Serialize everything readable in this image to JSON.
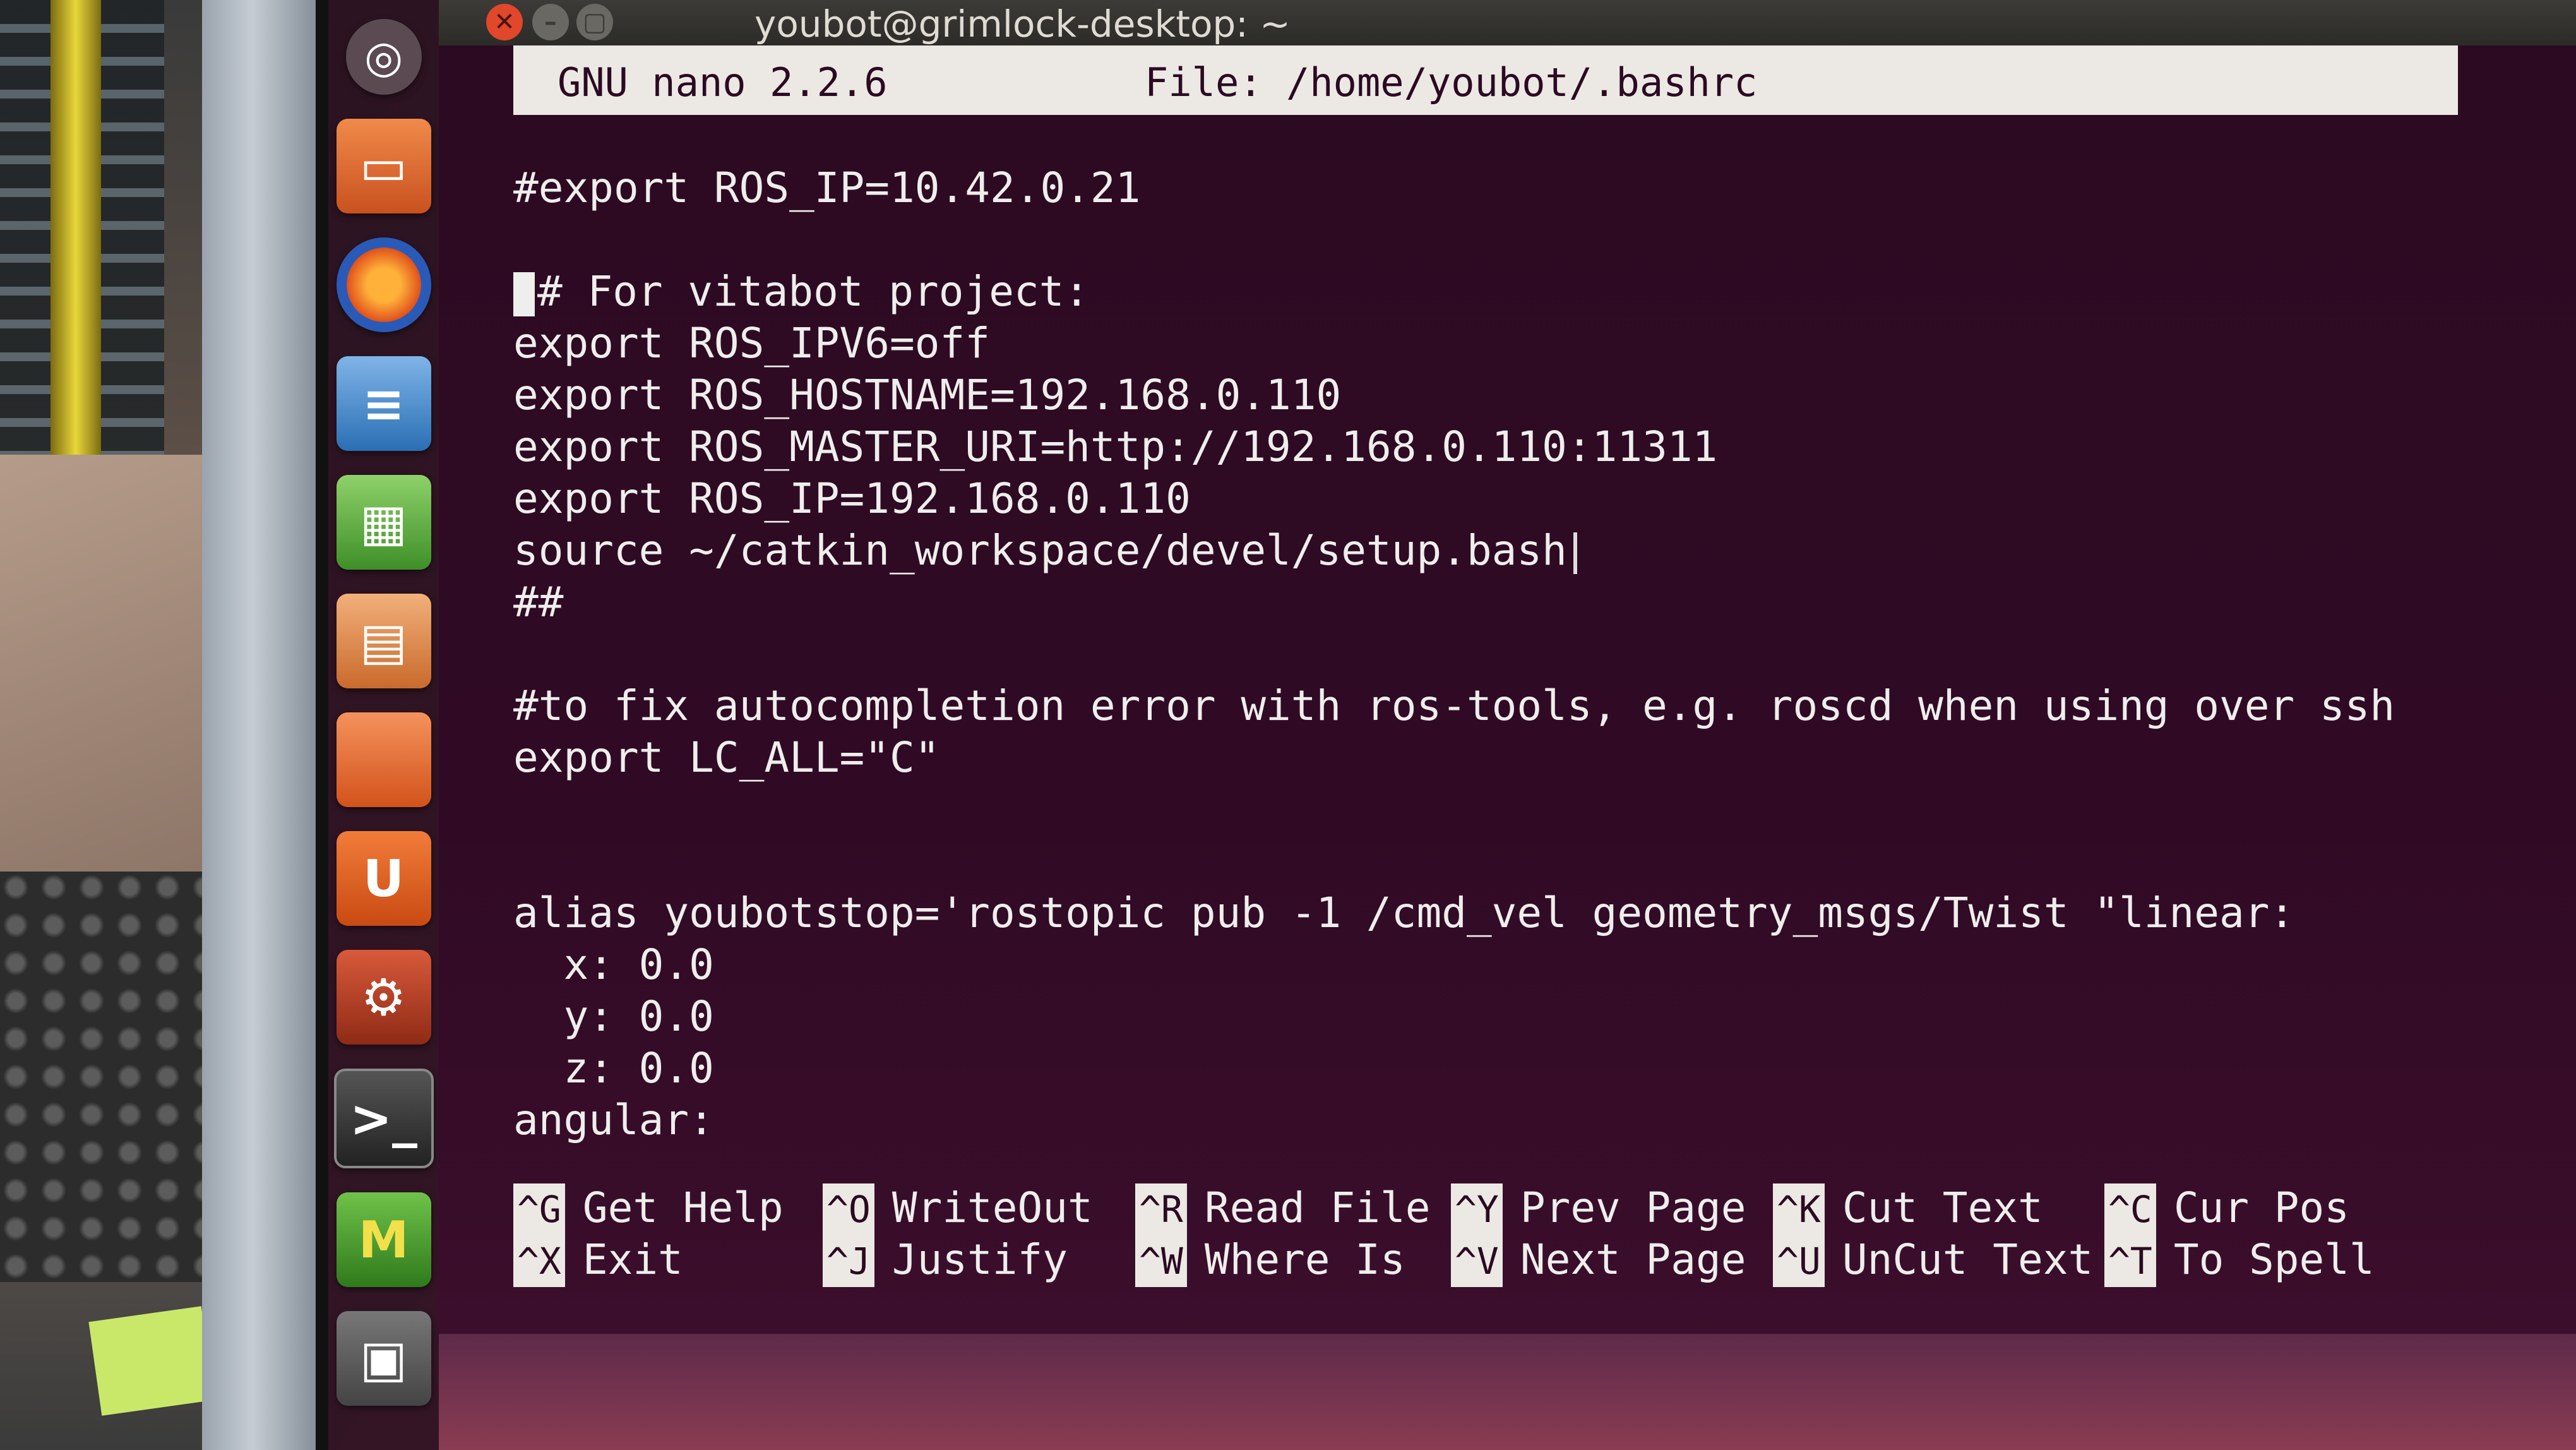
{
  "window": {
    "title": "youbot@grimlock-desktop: ~",
    "close_glyph": "✕",
    "min_glyph": "–",
    "max_glyph": "▢"
  },
  "launcher": {
    "items": [
      {
        "name": "dash",
        "glyph": "◎"
      },
      {
        "name": "files",
        "glyph": "▭"
      },
      {
        "name": "firefox",
        "glyph": ""
      },
      {
        "name": "libreoffice-writer",
        "glyph": "≡"
      },
      {
        "name": "libreoffice-calc",
        "glyph": "▦"
      },
      {
        "name": "libreoffice-impress",
        "glyph": "▤"
      },
      {
        "name": "software-center",
        "glyph": ""
      },
      {
        "name": "ubuntu-one",
        "glyph": "U"
      },
      {
        "name": "system-settings",
        "glyph": "⚙"
      },
      {
        "name": "terminal",
        "glyph": ">_"
      },
      {
        "name": "mendeley",
        "glyph": "M"
      },
      {
        "name": "workspace-switcher",
        "glyph": "▣"
      }
    ]
  },
  "nano": {
    "version": "GNU nano 2.2.6",
    "file_label": "File: /home/youbot/.bashrc",
    "lines": [
      "#export ROS_IP=10.42.0.21",
      "",
      "# For vitabot project:",
      "export ROS_IPV6=off",
      "export ROS_HOSTNAME=192.168.0.110",
      "export ROS_MASTER_URI=http://192.168.0.110:11311",
      "export ROS_IP=192.168.0.110",
      "source ~/catkin_workspace/devel/setup.bash",
      "##",
      "",
      "#to fix autocompletion error with ros-tools, e.g. roscd when using over ssh",
      "export LC_ALL=\"C\"",
      "",
      "",
      "alias youbotstop='rostopic pub -1 /cmd_vel geometry_msgs/Twist \"linear:",
      "  x: 0.0",
      "  y: 0.0",
      "  z: 0.0",
      "angular:"
    ],
    "shortcuts": [
      {
        "key": "^G",
        "label": "Get Help"
      },
      {
        "key": "^O",
        "label": "WriteOut"
      },
      {
        "key": "^R",
        "label": "Read File"
      },
      {
        "key": "^Y",
        "label": "Prev Page"
      },
      {
        "key": "^K",
        "label": "Cut Text"
      },
      {
        "key": "^C",
        "label": "Cur Pos"
      },
      {
        "key": "^X",
        "label": "Exit"
      },
      {
        "key": "^J",
        "label": "Justify"
      },
      {
        "key": "^W",
        "label": "Where Is"
      },
      {
        "key": "^V",
        "label": "Next Page"
      },
      {
        "key": "^U",
        "label": "UnCut Text"
      },
      {
        "key": "^T",
        "label": "To Spell"
      }
    ]
  }
}
